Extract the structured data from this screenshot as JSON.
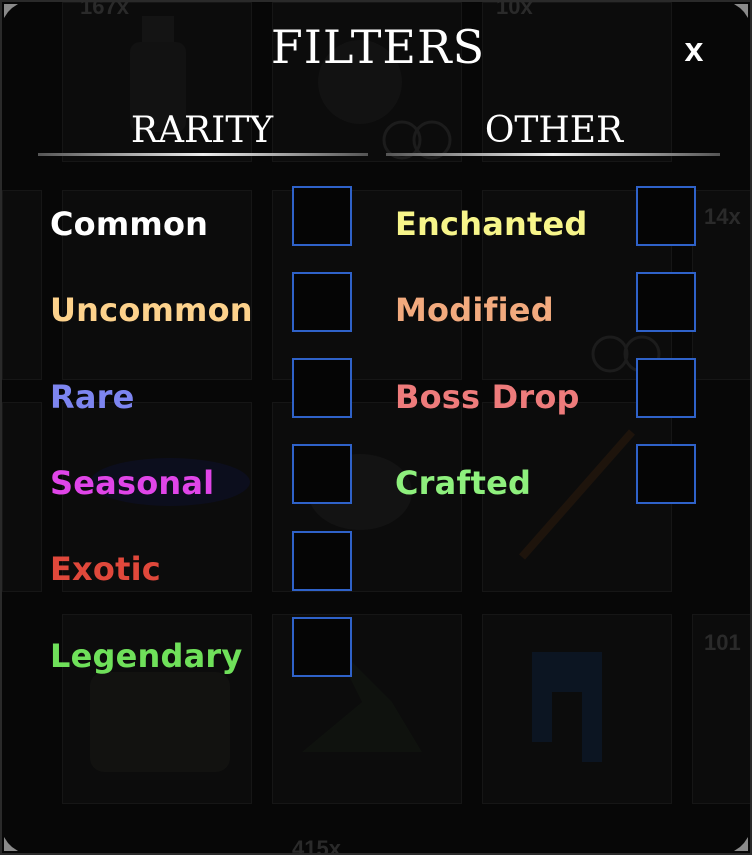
{
  "title": "FILTERS",
  "close_label": "x",
  "sections": {
    "rarity": {
      "heading": "RARITY",
      "items": [
        {
          "label": "Common",
          "color": "#ffffff",
          "checked": false
        },
        {
          "label": "Uncommon",
          "color": "#fdd28c",
          "checked": false
        },
        {
          "label": "Rare",
          "color": "#7d85f0",
          "checked": false
        },
        {
          "label": "Seasonal",
          "color": "#e045e8",
          "checked": false
        },
        {
          "label": "Exotic",
          "color": "#e0483b",
          "checked": false
        },
        {
          "label": "Legendary",
          "color": "#6fe05a",
          "checked": false
        }
      ]
    },
    "other": {
      "heading": "OTHER",
      "items": [
        {
          "label": "Enchanted",
          "color": "#f7f58a",
          "checked": false
        },
        {
          "label": "Modified",
          "color": "#f2aa7e",
          "checked": false
        },
        {
          "label": "Boss Drop",
          "color": "#ee7b7b",
          "checked": false
        },
        {
          "label": "Crafted",
          "color": "#8ef07d",
          "checked": false
        }
      ]
    }
  },
  "background_counts": [
    "167x",
    "10x",
    "14x",
    "101",
    "415x"
  ],
  "checkbox_border_color": "#2f62c9"
}
